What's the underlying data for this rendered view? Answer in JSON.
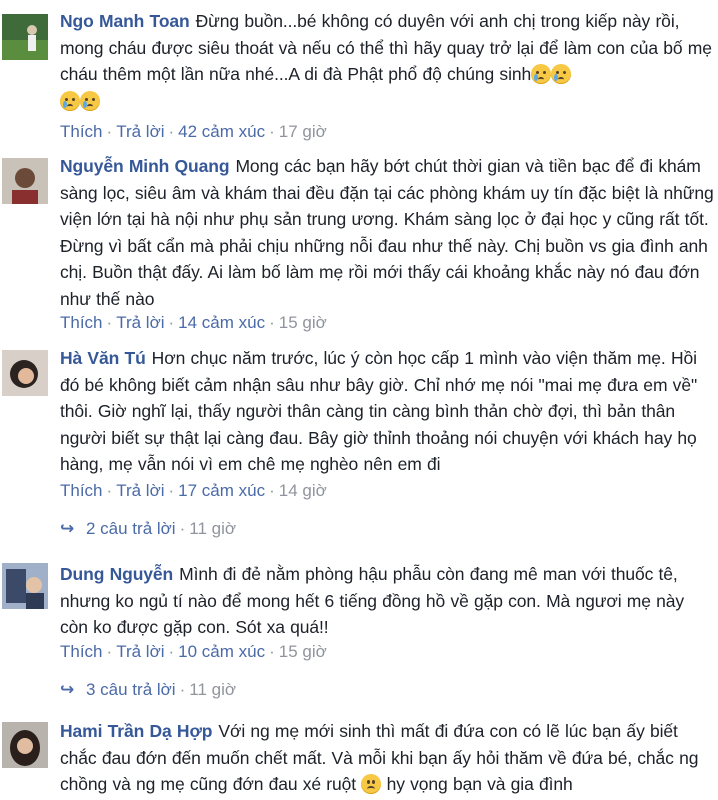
{
  "comments": [
    {
      "author": "Ngo Manh Toan",
      "text": "Đừng buồn...bé không có duyên với anh chị trong kiếp này rồi, mong cháu được siêu thoát và nếu có thể thì hãy quay trở lại để làm con của bố mẹ cháu thêm một lần nữa nhé...A di đà Phật phổ độ chúng sinh",
      "trailing_emoji": "crying-face-emoji",
      "like_label": "Thích",
      "reply_label": "Trả lời",
      "reactions": "42 cảm xúc",
      "time": "17 giờ"
    },
    {
      "author": "Nguyễn Minh Quang",
      "text": "Mong các bạn hãy bớt chút thời gian và tiền bạc để đi khám sàng lọc, siêu âm và khám thai đều đặn tại các phòng khám uy tín đặc biệt là những viện lớn tại hà nội như phụ sản trung ương. Khám sàng lọc ở đại học y cũng rất tốt. Đừng vì bất cẩn mà phải chịu những nỗi đau như thế này. Chị buồn vs gia đình anh chị. Buồn thật đấy. Ai làm bố làm mẹ rồi mới thấy cái khoảng khắc này nó đau đớn như thế nào",
      "like_label": "Thích",
      "reply_label": "Trả lời",
      "reactions": "14 cảm xúc",
      "time": "15 giờ"
    },
    {
      "author": "Hà Văn Tú",
      "text": "Hơn chục năm trước, lúc ý còn học cấp 1 mình vào viện thăm mẹ. Hồi đó bé không biết cảm nhận sâu như bây giờ. Chỉ nhớ mẹ nói \"mai mẹ đưa em về\" thôi. Giờ nghĩ lại, thấy người thân càng tin càng bình thản chờ đợi, thì bản thân người biết sự thật lại càng đau. Bây giờ thỉnh thoảng nói chuyện với khách hay họ hàng, mẹ vẫn nói vì em chê mẹ nghèo nên em đi",
      "like_label": "Thích",
      "reply_label": "Trả lời",
      "reactions": "17 cảm xúc",
      "time": "14 giờ",
      "replies_label": "2 câu trả lời",
      "replies_time": "11 giờ"
    },
    {
      "author": "Dung Nguyễn",
      "text": "Mình đi đẻ nằm phòng hậu phẫu còn đang mê man với thuốc tê, nhưng ko ngủ tí nào để mong hết 6 tiếng đồng hồ về gặp con. Mà ngươi mẹ này còn ko được gặp con. Sót xa quá!!",
      "like_label": "Thích",
      "reply_label": "Trả lời",
      "reactions": "10 cảm xúc",
      "time": "15 giờ",
      "replies_label": "3 câu trả lời",
      "replies_time": "11 giờ"
    },
    {
      "author": "Hami Trần Dạ Hợp",
      "text_before_emoji": "Với ng mẹ mới sinh thì mất đi đứa con có lẽ lúc bạn ấy biết chắc đau đớn đến muốn chết mất. Và mỗi khi bạn ấy hỏi thăm về đứa bé, chắc ng chồng và ng mẹ cũng đớn đau xé ruột",
      "text_after_emoji": "hy vọng bạn và gia đình",
      "inline_emoji": "sad-face-emoji"
    }
  ],
  "colors": {
    "author": "#365899",
    "link": "#4b6aa8",
    "meta": "#90949c",
    "text": "#1d2129"
  }
}
